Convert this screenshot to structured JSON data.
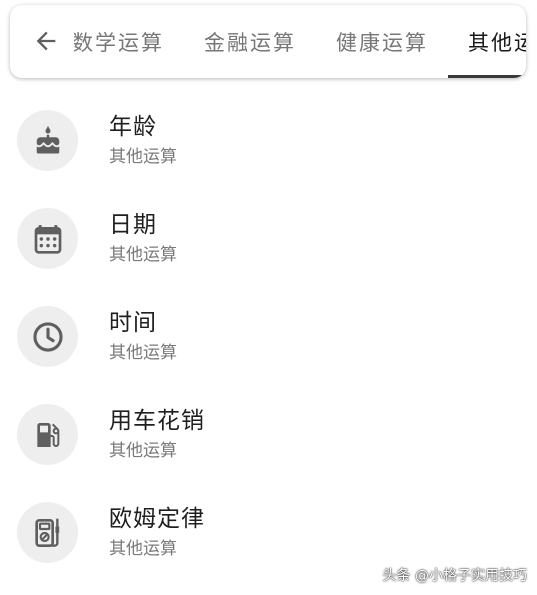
{
  "header": {
    "back_icon": "arrow-back-icon",
    "tabs": [
      {
        "label": "数学运算",
        "active": false
      },
      {
        "label": "金融运算",
        "active": false
      },
      {
        "label": "健康运算",
        "active": false
      },
      {
        "label": "其他运算",
        "active": true
      }
    ]
  },
  "items": [
    {
      "title": "年龄",
      "subtitle": "其他运算",
      "icon": "cake-icon"
    },
    {
      "title": "日期",
      "subtitle": "其他运算",
      "icon": "calendar-icon"
    },
    {
      "title": "时间",
      "subtitle": "其他运算",
      "icon": "clock-icon"
    },
    {
      "title": "用车花销",
      "subtitle": "其他运算",
      "icon": "fuel-pump-icon"
    },
    {
      "title": "欧姆定律",
      "subtitle": "其他运算",
      "icon": "multimeter-icon"
    }
  ],
  "watermark": "头条 @小格子实用技巧",
  "colors": {
    "icon": "#5f5f5f",
    "icon_background": "#eeeeee",
    "active_tab_text": "#1a1a1a",
    "inactive_tab_text": "#777777"
  }
}
